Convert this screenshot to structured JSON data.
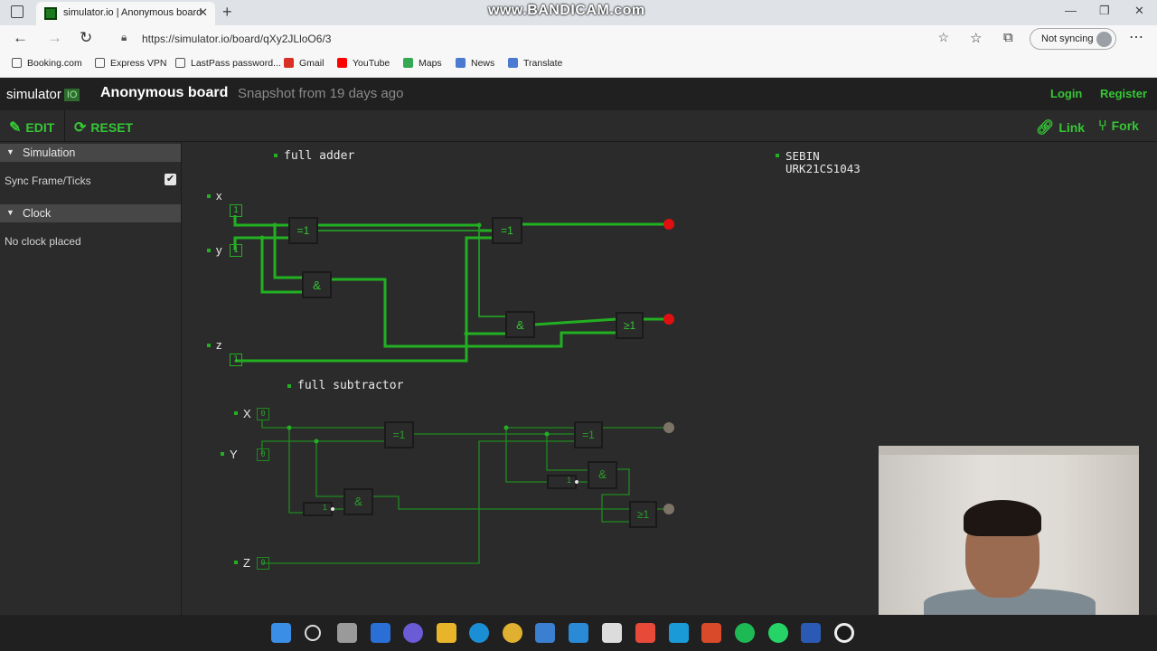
{
  "browser": {
    "tab_title": "simulator.io | Anonymous board",
    "url": "https://simulator.io/board/qXy2JLloO6/3",
    "profile_label": "Not syncing",
    "watermark": "www.BANDICAM.com",
    "bookmarks": [
      {
        "label": "Booking.com",
        "color": "#555555"
      },
      {
        "label": "Express VPN",
        "color": "#555555"
      },
      {
        "label": "LastPass password...",
        "color": "#555555"
      },
      {
        "label": "Gmail",
        "color": "#d93025"
      },
      {
        "label": "YouTube",
        "color": "#ff0000"
      },
      {
        "label": "Maps",
        "color": "#34a853"
      },
      {
        "label": "News",
        "color": "#4a7bd0"
      },
      {
        "label": "Translate",
        "color": "#4a7bd0"
      }
    ]
  },
  "app": {
    "logo_text": "simulator",
    "logo_badge": "IO",
    "board_title": "Anonymous board",
    "snapshot_text": "Snapshot from 19 days ago",
    "login_label": "Login",
    "register_label": "Register",
    "edit_label": "EDIT",
    "reset_label": "RESET",
    "link_label": "Link",
    "fork_label": "Fork",
    "accent_color": "#36c636"
  },
  "sidebar": {
    "simulation_title": "Simulation",
    "sync_label": "Sync Frame/Ticks",
    "sync_checked": true,
    "clock_title": "Clock",
    "clock_text": "No clock placed"
  },
  "board": {
    "adder_title": "full adder",
    "subtractor_title": "full subtractor",
    "author_name": "SEBIN",
    "author_id": "URK21CS1043",
    "adder_inputs": [
      {
        "label": "x",
        "value": "1"
      },
      {
        "label": "y",
        "value": "1"
      },
      {
        "label": "z",
        "value": "1"
      }
    ],
    "subtractor_inputs": [
      {
        "label": "X",
        "value": "0"
      },
      {
        "label": "Y",
        "value": "0"
      },
      {
        "label": "Z",
        "value": "0"
      }
    ],
    "gate_xor": "=1",
    "gate_and": "&",
    "gate_or": "≥1",
    "gate_not": "1",
    "led_on_color": "#e01010",
    "led_off_color": "#7c7466",
    "wire_on_color": "#22b022",
    "wire_off_color": "#1f8a1f"
  }
}
